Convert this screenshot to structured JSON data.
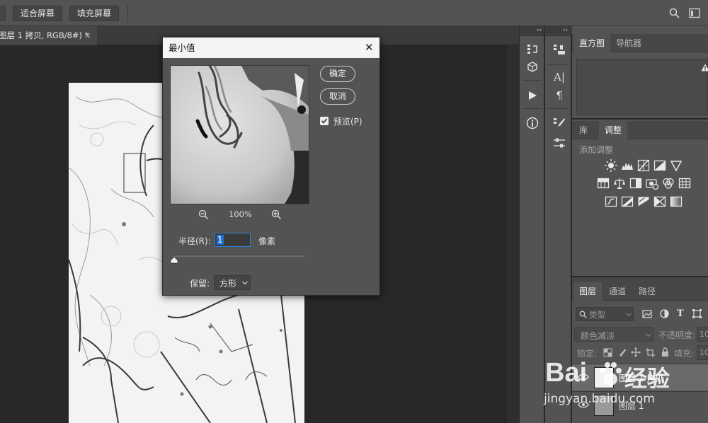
{
  "optionsbar": {
    "fit_screen": "适合屏幕",
    "fill_screen": "填充屏幕"
  },
  "document": {
    "tab_title": "图层 1 拷贝, RGB/8#) *",
    "close": "×"
  },
  "dialog": {
    "title": "最小值",
    "close": "✕",
    "ok": "确定",
    "cancel": "取消",
    "preview_label": "预览(P)",
    "zoom": "100%",
    "radius_label": "半径(R):",
    "radius_value": "1",
    "radius_unit": "像素",
    "preserve_label": "保留:",
    "preserve_value": "方形",
    "slider_fraction": 0.0
  },
  "panels": {
    "collapse": "‹‹",
    "histogram_tabs": [
      "直方图",
      "导航器"
    ],
    "adjust_tabs": [
      "库",
      "调整"
    ],
    "adjust_subtitle": "添加调整",
    "layers_tabs": [
      "图层",
      "通道",
      "路径"
    ],
    "kind_filter": "类型",
    "blend_mode": "颜色减淡",
    "opacity_label": "不透明度:",
    "opacity_value": "10",
    "lock_label": "锁定:",
    "fill_label": "填充:",
    "fill_value": "10",
    "layers": [
      {
        "name": "图层 1 拷贝"
      },
      {
        "name": "图层 1"
      }
    ]
  },
  "watermark": {
    "brand": "Bai",
    "brand2": "经验",
    "url": "jingyan.baidu.com"
  },
  "colors": {
    "ui_gray": "#535353",
    "canvas_bg": "#282828",
    "accent_blue": "#1f6fd1"
  }
}
